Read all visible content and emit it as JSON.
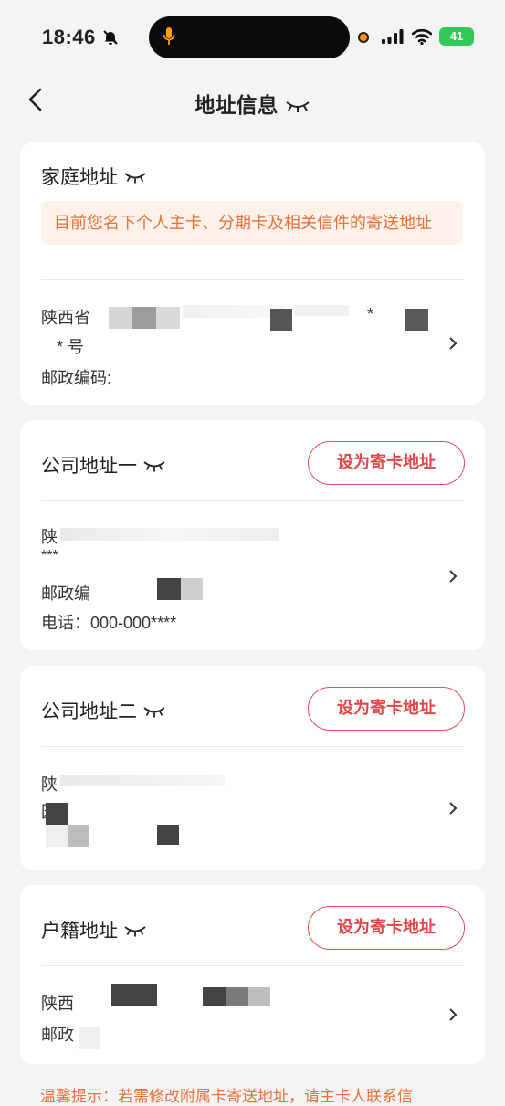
{
  "status_bar": {
    "time": "18:46",
    "battery": "41"
  },
  "header": {
    "title": "地址信息"
  },
  "home_card": {
    "title": "家庭地址",
    "notice": "目前您名下个人主卡、分期卡及相关信件的寄送地址",
    "address_line1": "陕西省",
    "address_line1_tail": "*",
    "address_line2": "*  号",
    "postal_label": "邮政编码:"
  },
  "company1_card": {
    "title": "公司地址一",
    "set_button": "设为寄卡地址",
    "address_line1": "陕",
    "address_line2": "***",
    "postal_label": "邮政编",
    "phone": "电话：000-000****"
  },
  "company2_card": {
    "title": "公司地址二",
    "set_button": "设为寄卡地址",
    "address_line1": "陕",
    "address_line2": "园"
  },
  "household_card": {
    "title": "户籍地址",
    "set_button": "设为寄卡地址",
    "address_line1": "陕西",
    "postal_label": "邮政"
  },
  "footer": {
    "tip": "温馨提示：若需修改附属卡寄送地址，请主卡人联系信"
  },
  "colors": {
    "accent": "#e04848",
    "notice_text": "#e8733a",
    "notice_bg": "#fdf1ea",
    "background": "#f4f3f6"
  },
  "icons": [
    "bell-slash-icon",
    "mic-icon",
    "cellular-signal-icon",
    "wifi-icon",
    "battery-icon",
    "back-arrow-icon",
    "eye-closed-icon",
    "chevron-right-icon"
  ]
}
